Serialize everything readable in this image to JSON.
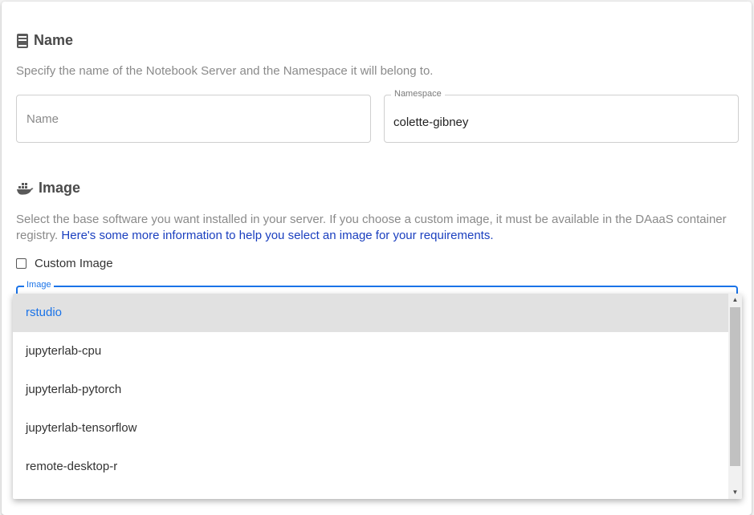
{
  "name_section": {
    "title": "Name",
    "icon": "book-icon",
    "description": "Specify the name of the Notebook Server and the Namespace it will belong to.",
    "name_field": {
      "placeholder": "Name",
      "value": ""
    },
    "namespace_field": {
      "label": "Namespace",
      "value": "colette-gibney"
    }
  },
  "image_section": {
    "title": "Image",
    "icon": "docker-icon",
    "description": "Select the base software you want installed in your server. If you choose a custom image, it must be available in the DAaaS container registry.",
    "help_link": "Here's some more information to help you select an image for your requirements.",
    "custom_image_label": "Custom Image",
    "custom_image_checked": false,
    "image_field_label": "Image",
    "options": [
      "rstudio",
      "jupyterlab-cpu",
      "jupyterlab-pytorch",
      "jupyterlab-tensorflow",
      "remote-desktop-r"
    ],
    "selected_option": "rstudio"
  },
  "colors": {
    "accent": "#1a73e8",
    "link": "#1a3fbf",
    "selected_bg": "#e1e1e1"
  }
}
